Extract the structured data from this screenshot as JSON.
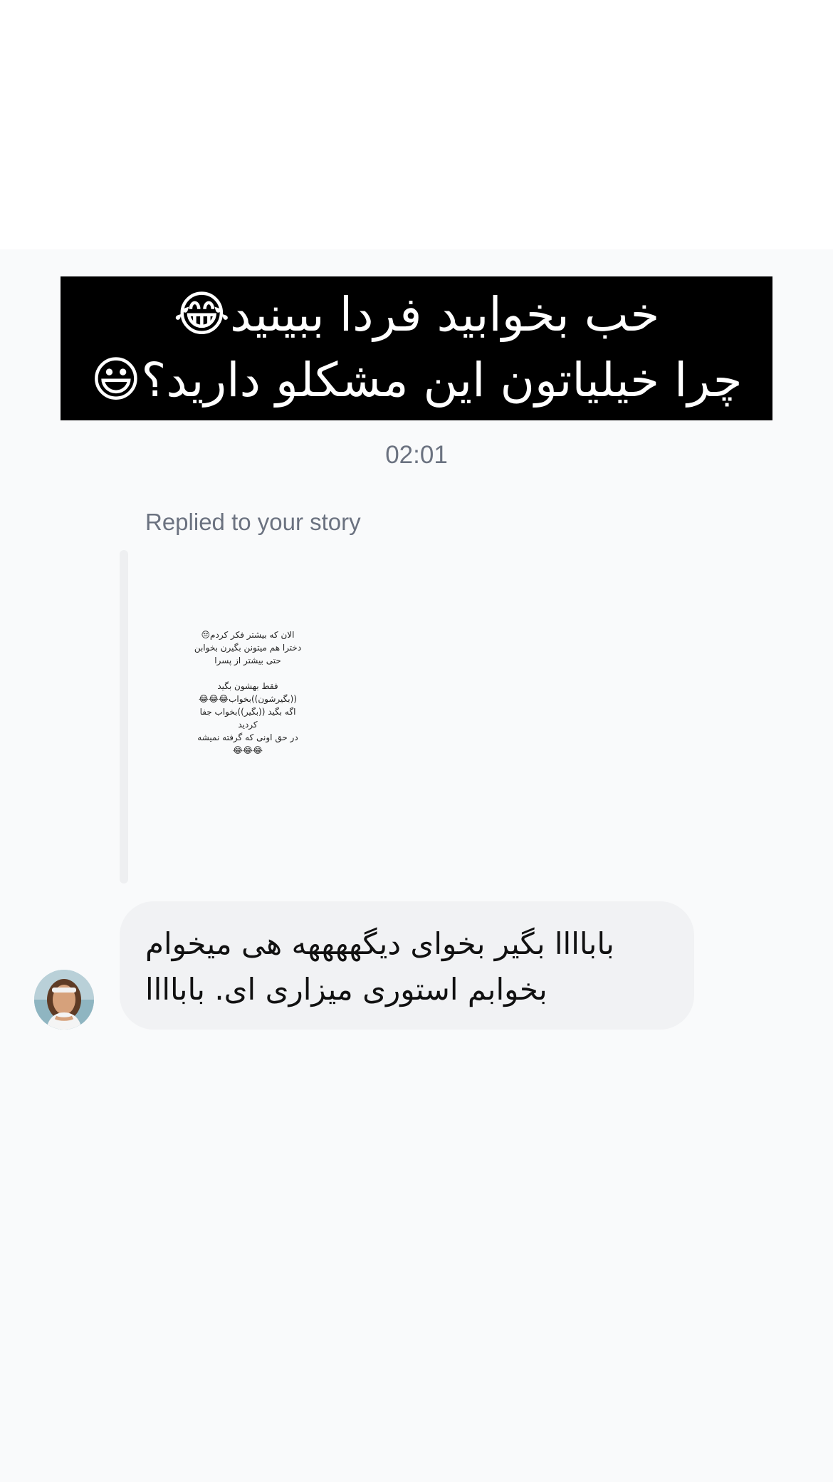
{
  "story_caption": {
    "line1": "خب بخوابید فردا ببینید",
    "line1_emoji": "😂",
    "line2": "چرا خیلیاتون این مشکلو دارید؟",
    "line2_emoji": "😃"
  },
  "thread": {
    "timestamp": "02:01",
    "reply_label": "Replied to your story"
  },
  "story_preview": {
    "lines": [
      "الان که بیشتر فکر کردم😔",
      "دخترا هم میتونن بگیرن بخوابن",
      "حتی بیشتر از پسرا",
      "",
      "فقط بهشون بگید",
      "((بگیرشون))بخواب😂😂😂",
      "اگه بگید ((بگیر))بخواب جفا",
      "کردید",
      "در حق اونی که گرفته نمیشه",
      "😂😂😂"
    ]
  },
  "message": {
    "lines": [
      "باباااا بگیر بخوای دیگههههه هی میخوام",
      "بخوابم استوری میزاری ای. باباااا"
    ]
  },
  "colors": {
    "background": "#f9fafb",
    "caption_background": "#000000",
    "caption_text": "#ffffff",
    "muted_text": "#6b7280",
    "reply_bar": "#eeeff1",
    "bubble": "#f1f2f4",
    "message_text": "#111111"
  }
}
